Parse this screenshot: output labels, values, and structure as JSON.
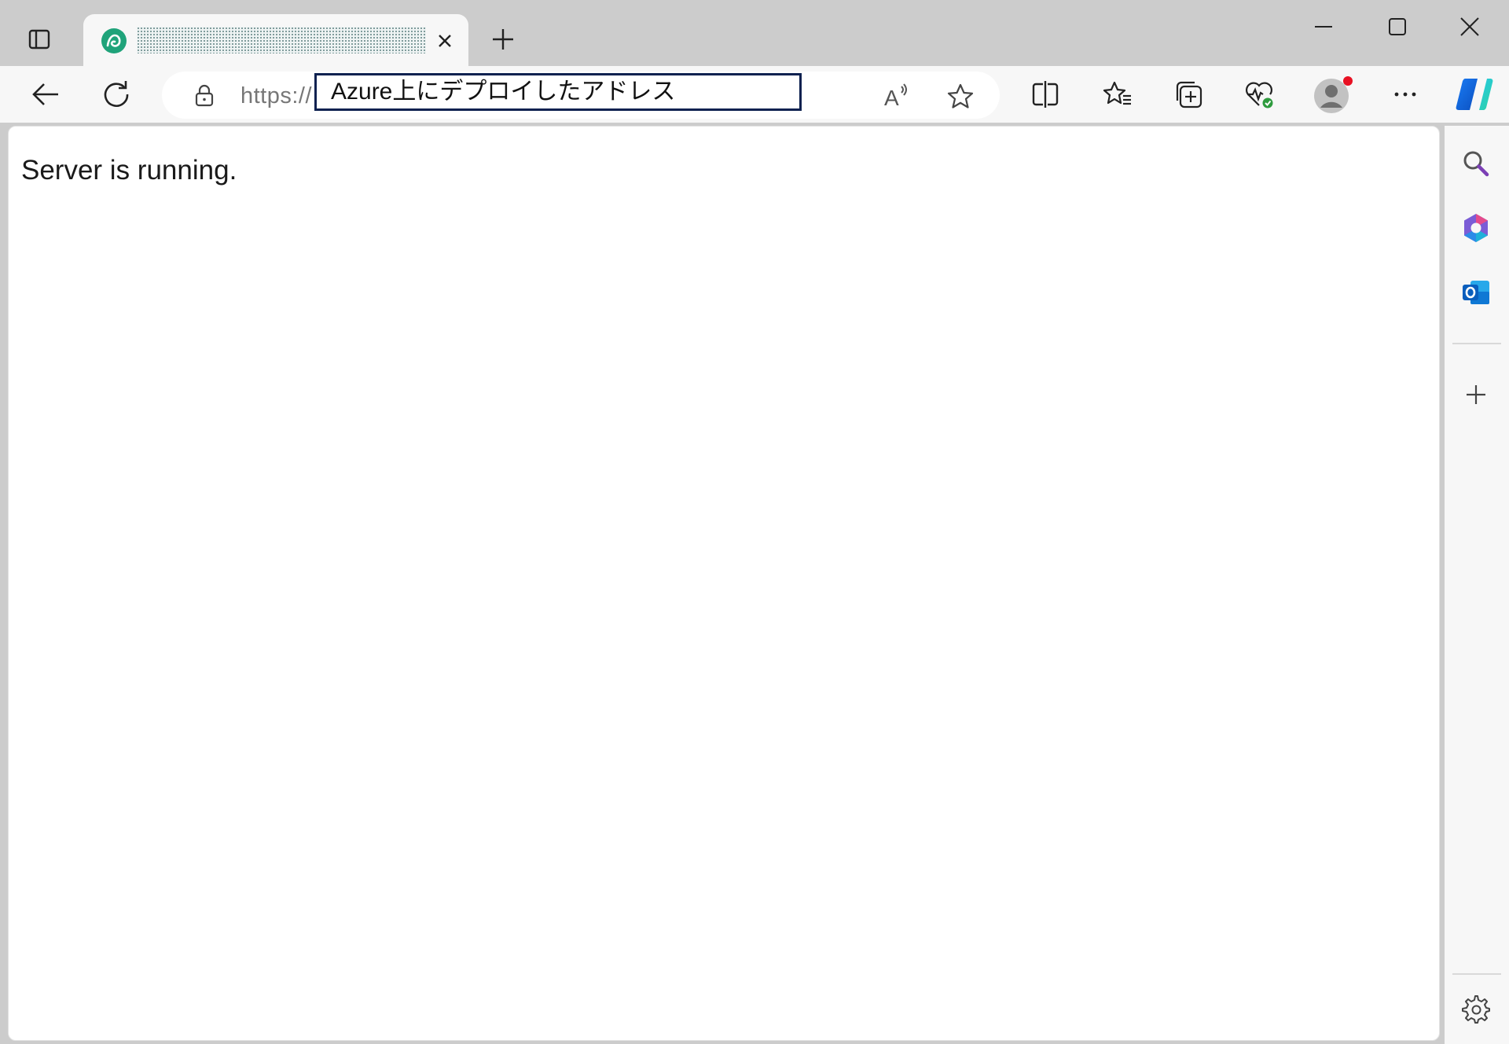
{
  "tab": {
    "title": "",
    "favicon": "app-service-logo-icon",
    "favicon_color": "#1fa37a"
  },
  "address_bar": {
    "url_prefix": "https://",
    "url_annotation": "Azure上にデプロイしたアドレス"
  },
  "page": {
    "body_text": "Server is running."
  },
  "colors": {
    "annotation_border": "#0d2150",
    "chrome_background": "#cccccc",
    "toolbar_background": "#f7f7f7",
    "profile_badge": "#e81123"
  },
  "icons": {
    "tab_actions": "tab-actions-icon",
    "close_tab": "close-icon",
    "new_tab": "plus-icon",
    "minimize": "minimize-icon",
    "maximize": "maximize-icon",
    "close_window": "close-icon",
    "back": "back-arrow-icon",
    "refresh": "refresh-icon",
    "lock": "lock-icon",
    "read_aloud": "read-aloud-icon",
    "favorite": "star-icon",
    "split_screen": "split-screen-icon",
    "favorites": "favorites-icon",
    "collections": "collections-icon",
    "browser_essentials": "heart-pulse-icon",
    "profile": "profile-avatar-icon",
    "more": "ellipsis-icon",
    "copilot": "copilot-icon",
    "sidebar_search": "search-icon",
    "sidebar_m365": "microsoft-365-icon",
    "sidebar_outlook": "outlook-icon",
    "sidebar_add": "plus-icon",
    "sidebar_settings": "gear-icon"
  }
}
